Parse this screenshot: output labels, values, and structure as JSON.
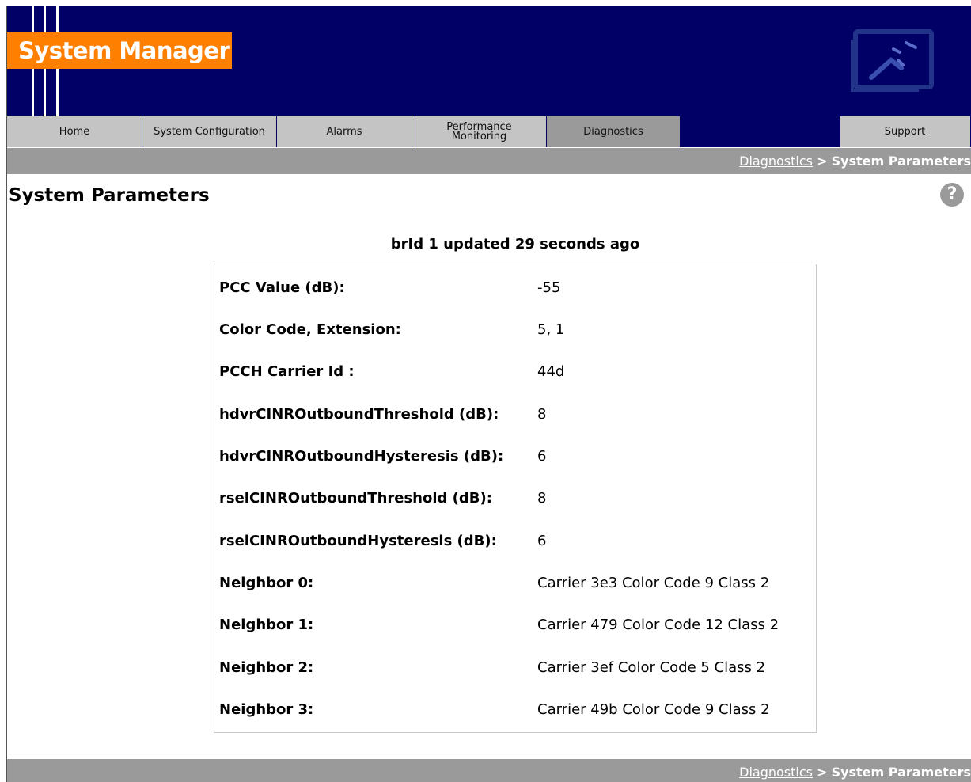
{
  "app": {
    "title": "System Manager"
  },
  "nav": {
    "tabs": [
      {
        "label": "Home"
      },
      {
        "label": "System Configuration"
      },
      {
        "label": "Alarms"
      },
      {
        "label_line1": "Performance",
        "label_line2": "Monitoring"
      },
      {
        "label": "Diagnostics",
        "active": true
      },
      {
        "label": "Support"
      }
    ]
  },
  "breadcrumb": {
    "link": "Diagnostics",
    "separator": ">",
    "current": "System Parameters"
  },
  "page": {
    "title": "System Parameters",
    "help_icon": "question-icon",
    "updated": "brId 1 updated 29 seconds ago"
  },
  "params": [
    {
      "label": "PCC Value (dB):",
      "value": "-55"
    },
    {
      "label": "Color Code, Extension:",
      "value": "5, 1"
    },
    {
      "label": "PCCH Carrier Id :",
      "value": "44d"
    },
    {
      "label": "hdvrCINROutboundThreshold (dB):",
      "value": "8"
    },
    {
      "label": "hdvrCINROutboundHysteresis (dB):",
      "value": "6"
    },
    {
      "label": "rselCINROutboundThreshold (dB):",
      "value": "8"
    },
    {
      "label": "rselCINROutboundHysteresis (dB):",
      "value": "6"
    },
    {
      "label": "Neighbor 0:",
      "value": "Carrier 3e3 Color Code 9 Class 2"
    },
    {
      "label": "Neighbor 1:",
      "value": "Carrier 479 Color Code 12 Class 2"
    },
    {
      "label": "Neighbor 2:",
      "value": "Carrier 3ef Color Code 5 Class 2"
    },
    {
      "label": "Neighbor 3:",
      "value": "Carrier 49b Color Code 9 Class 2"
    }
  ],
  "colors": {
    "banner": "#000066",
    "logo": "#ff7f00",
    "tab": "#c4c4c4",
    "tab_active": "#9a9a9a",
    "bar": "#9a9a9a"
  }
}
